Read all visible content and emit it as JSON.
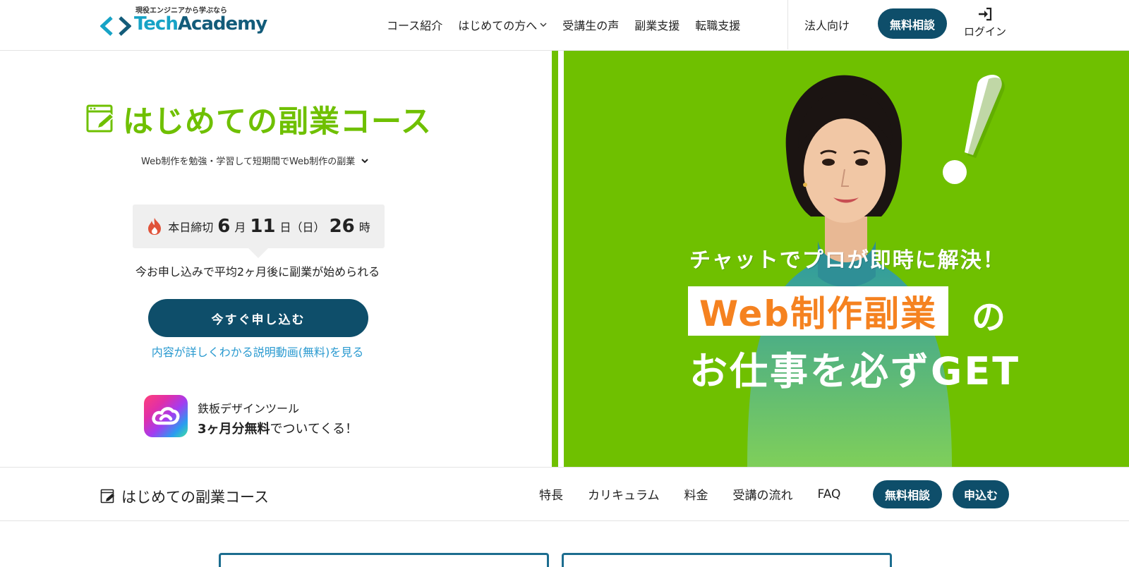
{
  "header": {
    "logo_tagline": "現役エンジニアから学ぶなら",
    "logo_text_a": "Tech",
    "logo_text_b": "Academy",
    "nav": [
      {
        "label": "コース紹介"
      },
      {
        "label": "はじめての方へ"
      },
      {
        "label": "受講生の声"
      },
      {
        "label": "副業支援"
      },
      {
        "label": "転職支援"
      }
    ],
    "corporate_label": "法人向け",
    "consult_label": "無料相談",
    "login_label": "ログイン"
  },
  "hero": {
    "course_title": "はじめての副業コース",
    "course_subtitle": "Web制作を勉強・学習して短期間でWeb制作の副業",
    "deadline": {
      "prefix": "本日締切",
      "month": "6",
      "month_unit": "月",
      "day": "11",
      "day_unit": "日",
      "weekday": "（日）",
      "hour": "26",
      "hour_unit": "時"
    },
    "avg_text": "今お申し込みで平均2ヶ月後に副業が始められる",
    "apply_label": "今すぐ申し込む",
    "video_link": "内容が詳しくわかる説明動画(無料)を見る",
    "promo_line1": "鉄板デザインツール",
    "promo_bold": "3ヶ月分無料",
    "promo_rest": "でついてくる！",
    "catch1": "チャットでプロが即時に解決！",
    "badge": "Web制作副業",
    "catch_no": "の",
    "catch3": "お仕事を必ずGET"
  },
  "subheader": {
    "brand": "はじめての副業コース",
    "nav": [
      {
        "label": "特長"
      },
      {
        "label": "カリキュラム"
      },
      {
        "label": "料金"
      },
      {
        "label": "受講の流れ"
      },
      {
        "label": "FAQ"
      }
    ],
    "consult_label": "無料相談",
    "apply_label": "申込む"
  },
  "colors": {
    "brand_green": "#6fc000",
    "brand_navy": "#0e4e6a",
    "link_blue": "#2a9ad0",
    "accent_orange": "#f58220"
  },
  "icons": {
    "logo": "code-brackets-icon",
    "login": "sign-in-icon",
    "course": "edit-window-icon",
    "deadline": "flame-icon",
    "promo": "creative-cloud-icon",
    "chevron": "chevron-down-icon"
  }
}
